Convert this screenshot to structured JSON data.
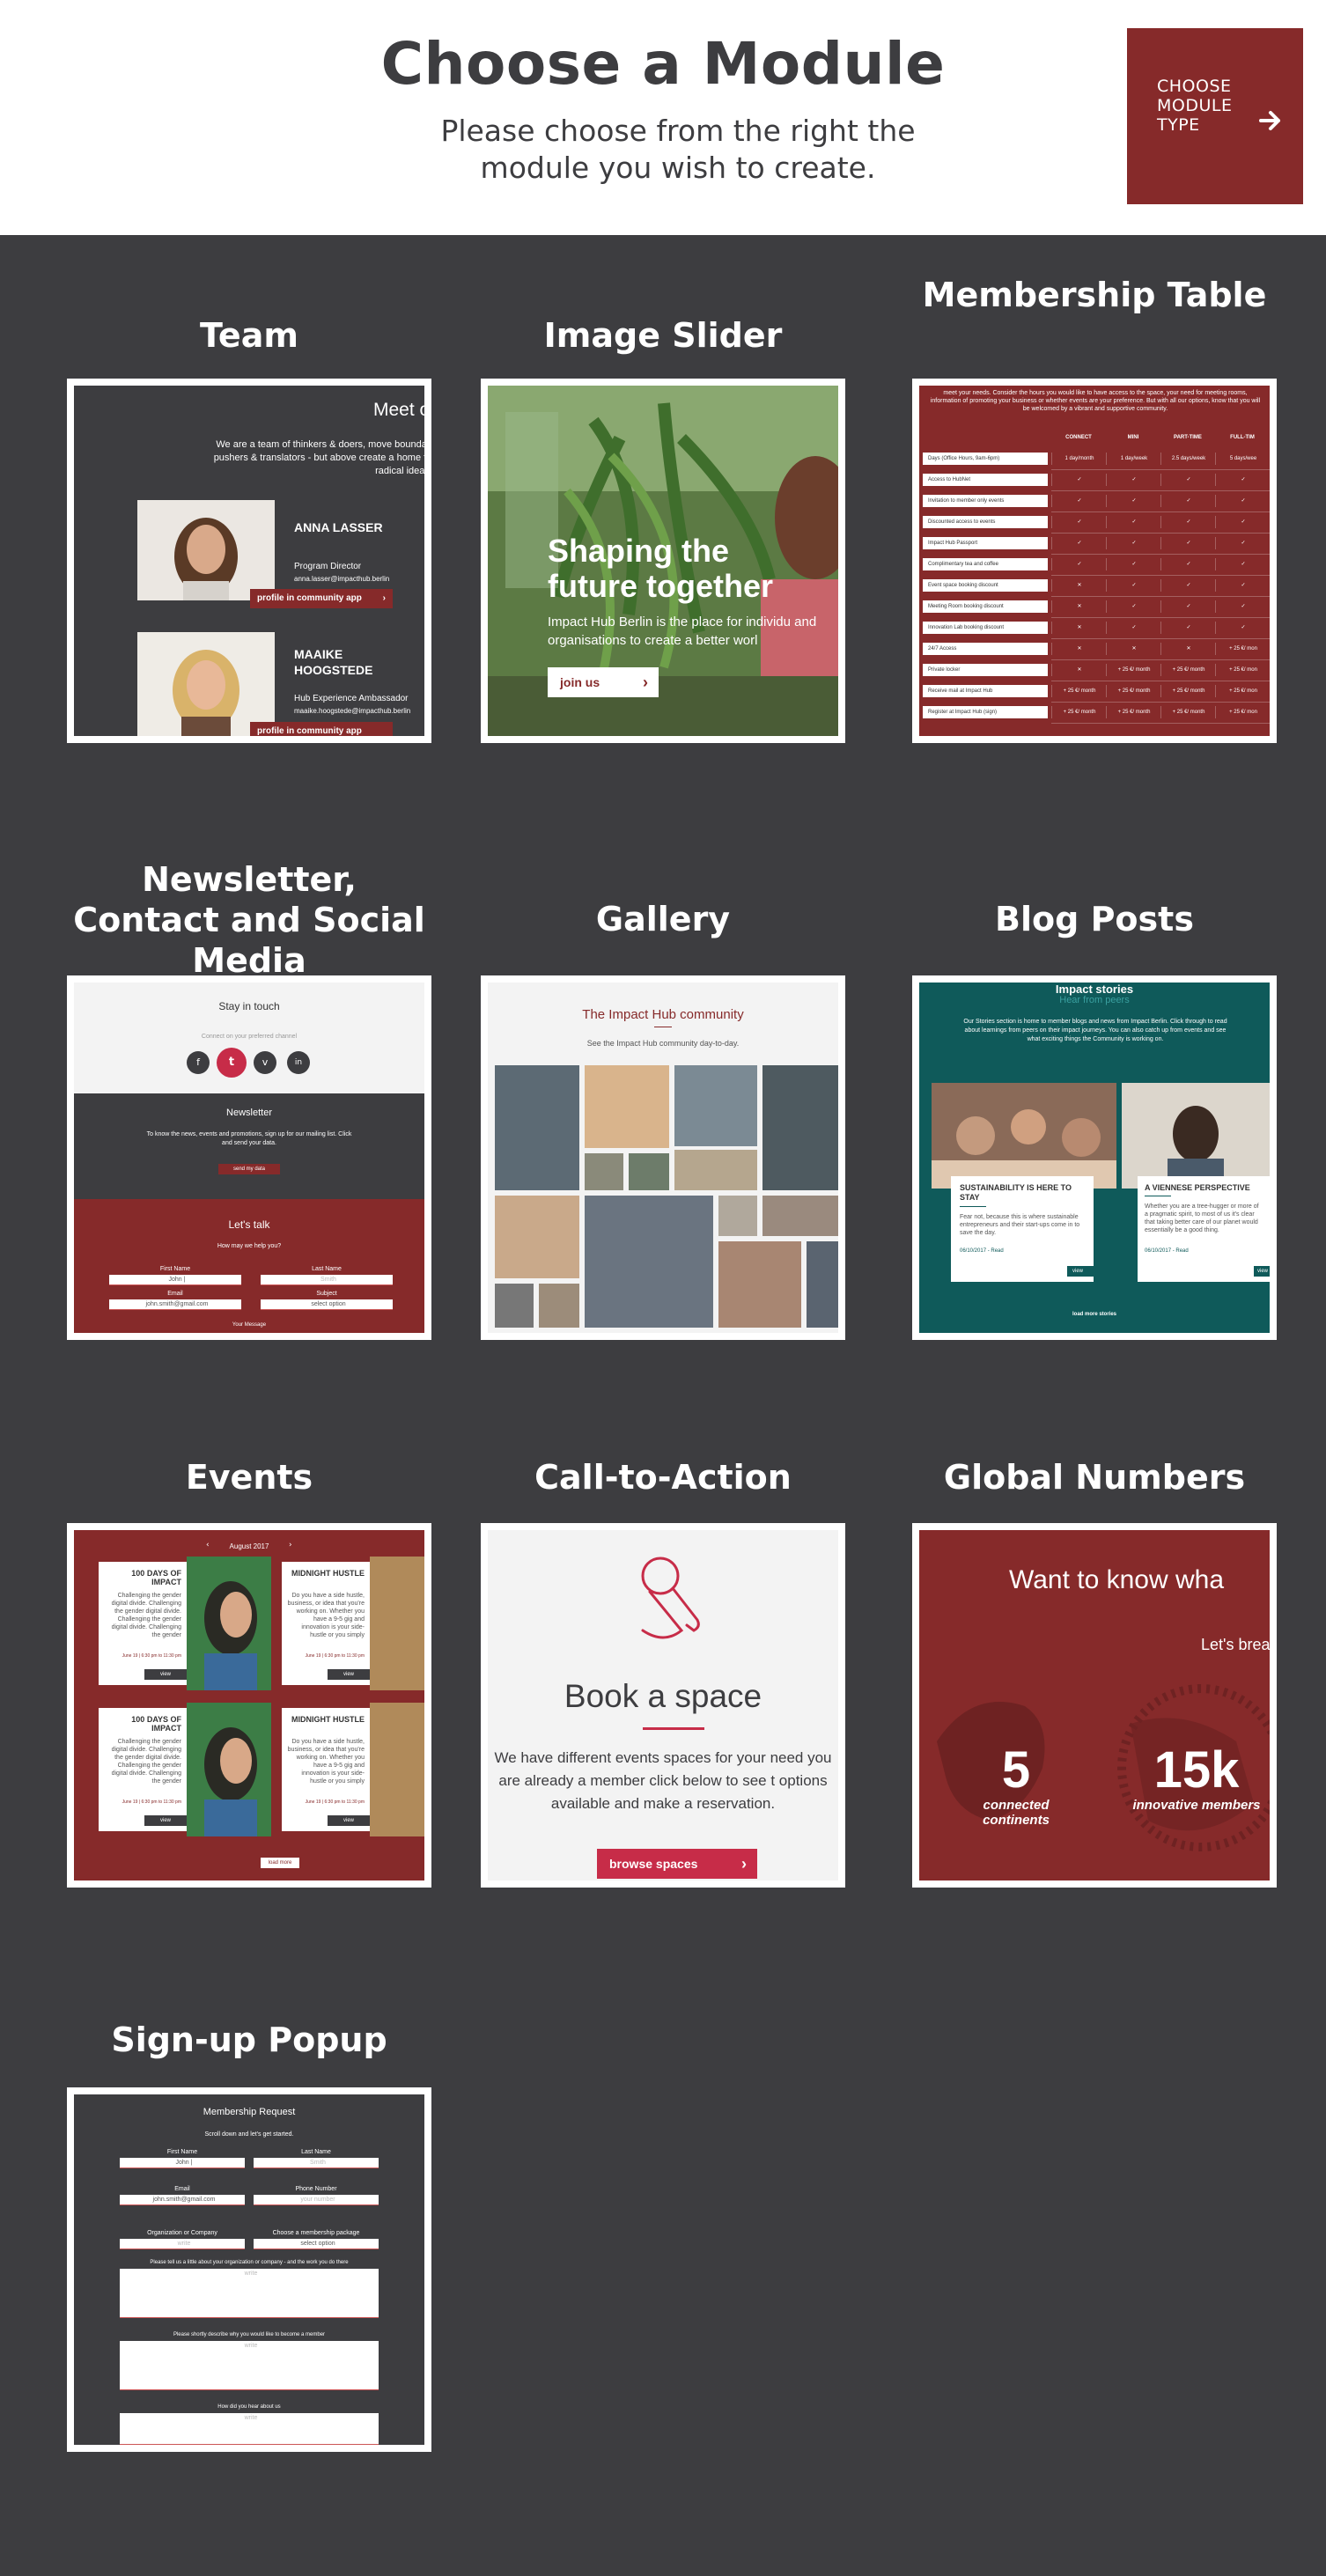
{
  "header": {
    "title": "Choose a Module",
    "subtitle": "Please choose from the right the module you wish to create.",
    "button_label": "CHOOSE MODULE TYPE"
  },
  "colors": {
    "brand_red": "#862a2a",
    "dark_bg": "#3d3d40",
    "teal": "#0f5a5a",
    "pink": "#c72c48"
  },
  "modules": {
    "team": {
      "title": "Team",
      "heading": "Meet o",
      "intro": "We are a team of thinkers & doers, move boundary pushers & translators - but above create a home for radical ideas t",
      "members": [
        {
          "name": "ANNA LASSER",
          "role": "Program Director",
          "email": "anna.lasser@impacthub.berlin",
          "button": "profile in community app"
        },
        {
          "name": "MAAIKE HOOGSTEDE",
          "role": "Hub Experience Ambassador",
          "email": "maaike.hoogstede@impacthub.berlin",
          "button": "profile in community app"
        }
      ]
    },
    "slider": {
      "title": "Image Slider",
      "headline": "Shaping the future together",
      "text": "Impact Hub Berlin is the place for individu and organisations to create a better worl",
      "button": "join us"
    },
    "membership": {
      "title": "Membership Table",
      "intro": "meet your needs. Consider the hours you would like to have access to the space, your need for meeting rooms, information of promoting your business or whether events are your preference. But with all our options, know that you will be welcomed by a vibrant and supportive community.",
      "columns": [
        "CONNECT",
        "MINI",
        "PART-TIME",
        "FULL-TIM"
      ],
      "rows": [
        {
          "label": "Days (Office Hours, 9am-6pm)",
          "cells": [
            "1 day/month",
            "1 day/week",
            "2.5 days/week",
            "5 days/wee"
          ]
        },
        {
          "label": "Access to HubNet",
          "cells": [
            "✓",
            "✓",
            "✓",
            "✓"
          ]
        },
        {
          "label": "Invitation to member only events",
          "cells": [
            "✓",
            "✓",
            "✓",
            "✓"
          ]
        },
        {
          "label": "Discounted access to events",
          "cells": [
            "✓",
            "✓",
            "✓",
            "✓"
          ]
        },
        {
          "label": "Impact Hub Passport",
          "cells": [
            "✓",
            "✓",
            "✓",
            "✓"
          ]
        },
        {
          "label": "Complimentary tea and coffee",
          "cells": [
            "✓",
            "✓",
            "✓",
            "✓"
          ]
        },
        {
          "label": "Event space booking discount",
          "cells": [
            "✕",
            "✓",
            "✓",
            "✓"
          ]
        },
        {
          "label": "Meeting Room booking discount",
          "cells": [
            "✕",
            "✓",
            "✓",
            "✓"
          ]
        },
        {
          "label": "Innovation Lab booking discount",
          "cells": [
            "✕",
            "✓",
            "✓",
            "✓"
          ]
        },
        {
          "label": "24/7 Access",
          "cells": [
            "✕",
            "✕",
            "✕",
            "+ 25 €/ mon"
          ]
        },
        {
          "label": "Private locker",
          "cells": [
            "✕",
            "+ 25 €/ month",
            "+ 25 €/ month",
            "+ 25 €/ mon"
          ]
        },
        {
          "label": "Receive mail at Impact Hub",
          "cells": [
            "+ 25 €/ month",
            "+ 25 €/ month",
            "+ 25 €/ month",
            "+ 25 €/ mon"
          ]
        },
        {
          "label": "Register at Impact Hub (sign)",
          "cells": [
            "+ 25 €/ month",
            "+ 25 €/ month",
            "+ 25 €/ month",
            "+ 25 €/ mon"
          ]
        }
      ]
    },
    "newsletter": {
      "title": "Newsletter, Contact and Social Media",
      "stay_title": "Stay in touch",
      "stay_sub": "Connect on your preferred channel",
      "social": [
        "f",
        "t",
        "v",
        "in"
      ],
      "news_title": "Newsletter",
      "news_text": "To know the news, events and promotions, sign up for our mailing list. Click and send your data.",
      "news_button": "send my data",
      "talk_title": "Let's talk",
      "talk_sub": "How may we help you?",
      "first_name_label": "First Name",
      "first_name_value": "John |",
      "last_name_label": "Last Name",
      "last_name_placeholder": "Smith",
      "email_label": "Email",
      "email_value": "john.smith@gmail.com",
      "subject_label": "Subject",
      "subject_value": "select option",
      "footer_label": "Your Message"
    },
    "gallery": {
      "title": "Gallery",
      "heading": "The Impact Hub community",
      "sub": "See the Impact Hub community day-to-day."
    },
    "blog": {
      "title": "Blog Posts",
      "heading": "Impact stories",
      "heading2": "Hear from peers",
      "intro": "Our Stories section is home to member blogs and news from Impact Berlin. Click through to read about learnings from peers on their impact journeys. You can also catch up from events and see what exciting things the Community is working on.",
      "posts": [
        {
          "title": "SUSTAINABILITY IS HERE TO STAY",
          "text": "Fear not, because this is where sustainable entrepreneurs and their start-ups come in to save the day.",
          "meta": "06/10/2017 - Read",
          "button": "view"
        },
        {
          "title": "A VIENNESE PERSPECTIVE",
          "text": "Whether you are a tree-hugger or more of a pragmatic spirit, to most of us it's clear that taking better care of our planet would essentially be a good thing.",
          "meta": "06/10/2017 - Read",
          "button": "view"
        }
      ],
      "footer": "load more stories"
    },
    "events": {
      "title": "Events",
      "month": "August 2017",
      "items": [
        {
          "title": "100 DAYS OF IMPACT",
          "text": "Challenging the gender digital divide. Challenging the gender digital divide. Challenging the gender digital divide. Challenging the gender",
          "date": "June 19 | 6:30 pm to 11:30 pm",
          "button": "view"
        },
        {
          "title": "MIDNIGHT HUSTLE",
          "text": "Do you have a side hustle, business, or idea that you're working on. Whether you have a 9-5 gig and innovation is your side-hustle or you simply",
          "date": "June 19 | 6:30 pm to 11:30 pm",
          "button": "view"
        },
        {
          "title": "100 DAYS OF IMPACT",
          "text": "Challenging the gender digital divide. Challenging the gender digital divide. Challenging the gender digital divide. Challenging the gender",
          "date": "June 19 | 6:30 pm to 11:30 pm",
          "button": "view"
        },
        {
          "title": "MIDNIGHT HUSTLE",
          "text": "Do you have a side hustle, business, or idea that you're working on. Whether you have a 9-5 gig and innovation is your side-hustle or you simply",
          "date": "June 19 | 6:30 pm to 11:30 pm",
          "button": "view"
        }
      ],
      "load_more": "load more"
    },
    "cta": {
      "title": "Call-to-Action",
      "heading": "Book a space",
      "text": "We have different events spaces for your need you are already a member click below to see t options available and make a reservation.",
      "button": "browse spaces"
    },
    "numbers": {
      "title": "Global Numbers",
      "heading": "Want to know wha",
      "sub": "Let's brea",
      "stats": [
        {
          "value": "5",
          "label": "connected continents"
        },
        {
          "value": "15k",
          "label": "innovative members"
        }
      ]
    },
    "signup": {
      "title": "Sign-up Popup",
      "heading": "Membership Request",
      "sub": "Scroll down and let's get started.",
      "first_name_label": "First Name",
      "first_name_value": "John |",
      "last_name_label": "Last Name",
      "last_name_placeholder": "Smith",
      "email_label": "Email",
      "email_value": "john.smith@gmail.com",
      "phone_label": "Phone Number",
      "phone_placeholder": "your number",
      "org_label": "Organization or Company",
      "org_placeholder": "write",
      "package_label": "Choose a membership package",
      "package_value": "select option",
      "about_label": "Please tell us a little about your organization or company - and the work you do there",
      "about_placeholder": "write",
      "why_label": "Please shortly describe why you would like to become a member",
      "why_placeholder": "write",
      "hear_label": "How did you hear about us",
      "hear_placeholder": "write"
    }
  }
}
